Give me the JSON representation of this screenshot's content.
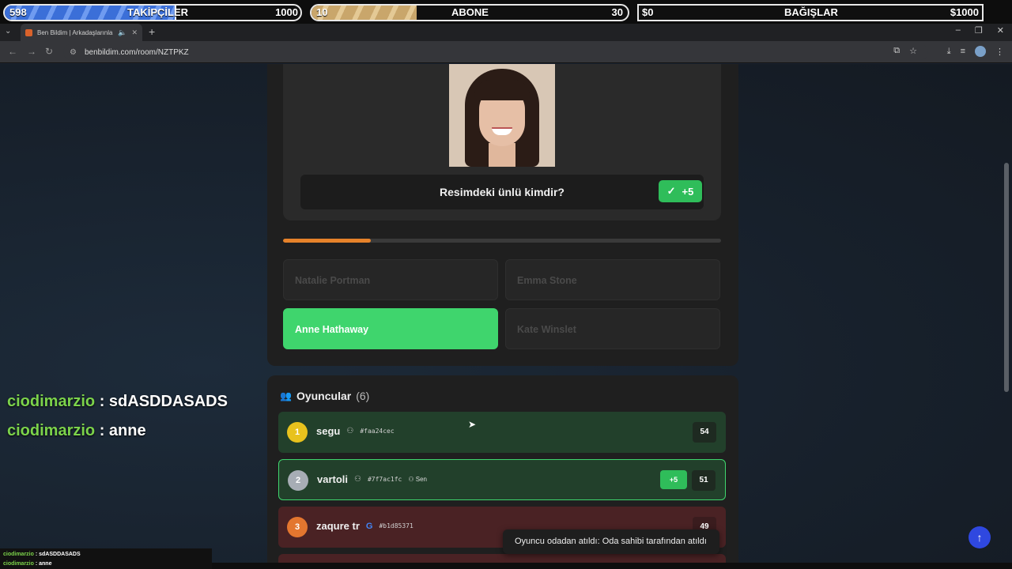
{
  "overlay": {
    "followers": {
      "current": "598",
      "label": "TAKİPÇİLER",
      "goal": "1000",
      "progress": 0.598
    },
    "subscribers": {
      "current": "10",
      "label": "ABONE",
      "goal": "30",
      "progress": 0.333
    },
    "donations": {
      "current": "$0",
      "label": "BAĞIŞLAR",
      "goal": "$1000",
      "progress": 0
    }
  },
  "browser": {
    "tab_title": "Ben Bildim | Arkadaşlarınla Bilgi Yarışması",
    "url": "benbildim.com/room/NZTPKZ"
  },
  "quiz": {
    "question": "Resimdeki ünlü kimdir?",
    "points_badge": "+5",
    "timer_progress": 0.2,
    "options": [
      {
        "label": "Natalie Portman",
        "state": "disabled"
      },
      {
        "label": "Emma Stone",
        "state": "disabled"
      },
      {
        "label": "Anne Hathaway",
        "state": "correct"
      },
      {
        "label": "Kate Winslet",
        "state": "disabled"
      }
    ]
  },
  "players": {
    "title": "Oyuncular",
    "count": "(6)",
    "list": [
      {
        "rank": "1",
        "name": "segu",
        "id": "#faa24cec",
        "score": "54"
      },
      {
        "rank": "2",
        "name": "vartoli",
        "id": "#7f7ac1fc",
        "you_label": "Sen",
        "gain": "+5",
        "score": "51"
      },
      {
        "rank": "3",
        "name": "zaqure tr",
        "id": "#b1d85371",
        "score": "49"
      }
    ]
  },
  "toast": {
    "message": "Oyuncu odadan atıldı: Oda sahibi tarafından atıldı"
  },
  "chat": {
    "messages": [
      {
        "user": "ciodimarzio",
        "text": "sdASDDASADS"
      },
      {
        "user": "ciodimarzio",
        "text": "anne"
      }
    ]
  },
  "colors": {
    "accent_orange": "#e6822a",
    "correct_green": "#3fd56d",
    "fab_blue": "#2f48e0"
  }
}
